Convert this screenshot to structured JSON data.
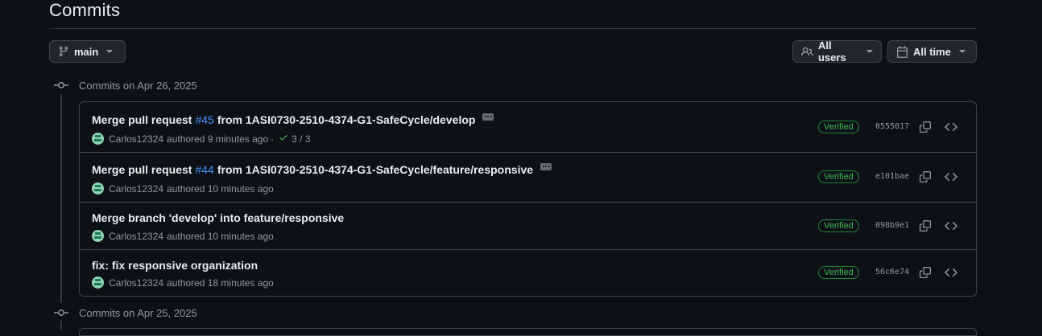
{
  "page": {
    "title": "Commits"
  },
  "filters": {
    "branch_label": "main",
    "users_label": "All users",
    "time_label": "All time"
  },
  "groups": [
    {
      "header": "Commits on Apr 26, 2025",
      "commits": [
        {
          "title_before": "Merge pull request",
          "pr": "#45",
          "title_after": "from 1ASI0730-2510-4374-G1-SafeCycle/develop",
          "author": "Carlos12324",
          "time_text": "authored 9 minutes ago",
          "checks_separator": "·",
          "checks": "3 / 3",
          "badge": "Verified",
          "sha": "0555017",
          "has_ellipsis": true
        },
        {
          "title_before": "Merge pull request",
          "pr": "#44",
          "title_after": "from 1ASI0730-2510-4374-G1-SafeCycle/feature/responsive",
          "author": "Carlos12324",
          "time_text": "authored 10 minutes ago",
          "badge": "Verified",
          "sha": "e101bae",
          "has_ellipsis": true
        },
        {
          "title": "Merge branch 'develop' into feature/responsive",
          "author": "Carlos12324",
          "time_text": "authored 10 minutes ago",
          "badge": "Verified",
          "sha": "098b9e1"
        },
        {
          "title": "fix: fix responsive organization",
          "author": "Carlos12324",
          "time_text": "authored 18 minutes ago",
          "badge": "Verified",
          "sha": "56c6e74"
        }
      ]
    },
    {
      "header": "Commits on Apr 25, 2025"
    }
  ],
  "icons": {
    "branch": "git-branch-icon",
    "users": "people-icon",
    "calendar": "calendar-icon",
    "commit": "git-commit-icon",
    "copy": "copy-icon",
    "browse": "code-icon",
    "check": "check-icon"
  },
  "colors": {
    "background": "#0d1117",
    "link": "#4493f8",
    "verified": "#3fb950",
    "border": "#3d444d"
  }
}
